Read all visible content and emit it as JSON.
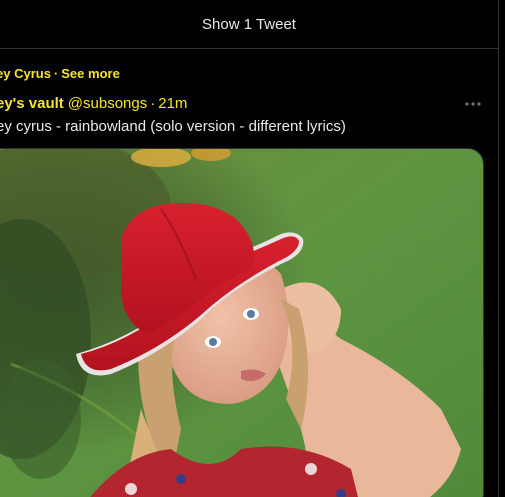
{
  "timeline": {
    "show_tweets_label": "Show 1 Tweet"
  },
  "tweet": {
    "context_name": "ey Cyrus",
    "context_separator": "·",
    "see_more_label": "See more",
    "author_name": "ey's vault",
    "author_handle": "@subsongs",
    "time_separator": "·",
    "timestamp": "21m",
    "text": "ey cyrus - rainbowland (solo version - different lyrics)",
    "more_icon": "more-horizontal-icon"
  },
  "colors": {
    "accent_yellow": "#f5e52a",
    "background": "#000000",
    "border": "#2f3336",
    "text": "#e7e9ea"
  }
}
